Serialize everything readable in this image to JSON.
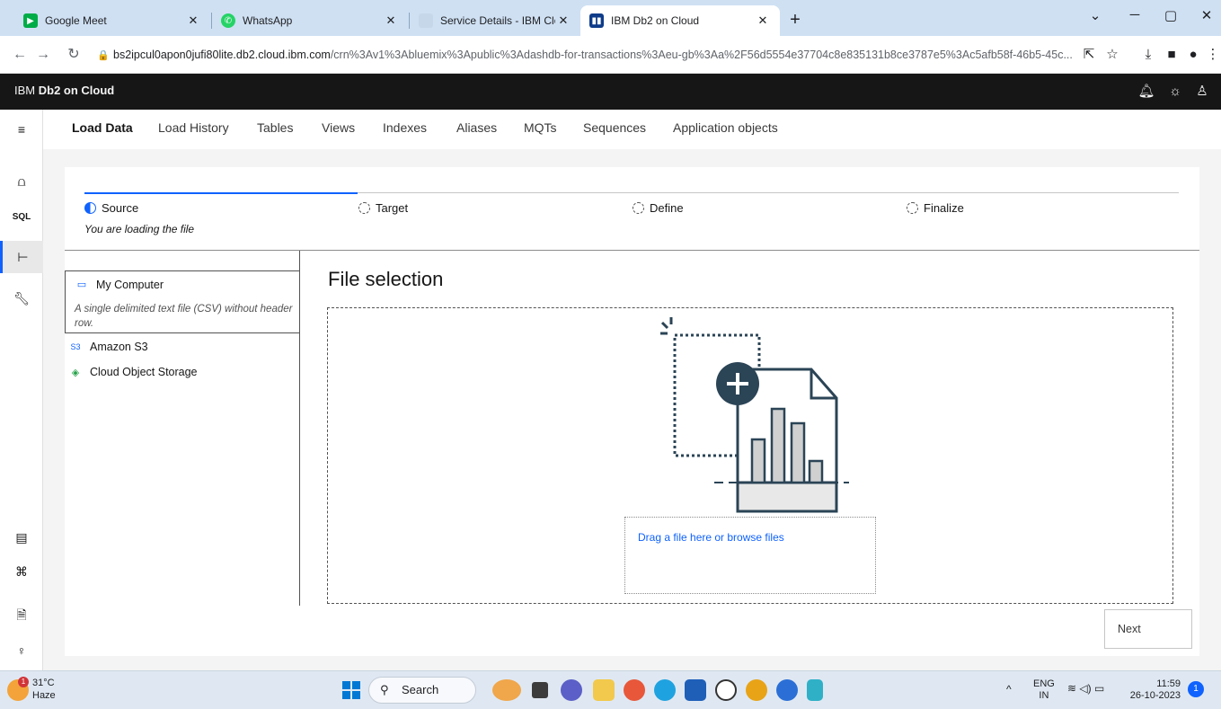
{
  "browser": {
    "tabs": [
      {
        "title": "Google Meet",
        "favicon_color": "#00ac47"
      },
      {
        "title": "WhatsApp",
        "favicon_color": "#25d366"
      },
      {
        "title": "Service Details - IBM Cloud",
        "favicon_color": "#c7d7ea"
      },
      {
        "title": "IBM Db2 on Cloud",
        "favicon_color": "#0f3c8a"
      }
    ],
    "url_host": "bs2ipcul0apon0jufi80lite.db2.cloud.ibm.com",
    "url_path": "/crn%3Av1%3Abluemix%3Apublic%3Adashdb-for-transactions%3Aeu-gb%3Aa%2F56d5554e37704c8e835131b8ce3787e5%3Ac5afb58f-46b5-45c..."
  },
  "app": {
    "brand_prefix": "IBM",
    "brand_name": "Db2 on Cloud"
  },
  "nav_tabs": [
    "Load Data",
    "Load History",
    "Tables",
    "Views",
    "Indexes",
    "Aliases",
    "MQTs",
    "Sequences",
    "Application objects"
  ],
  "progress": {
    "steps": [
      "Source",
      "Target",
      "Define",
      "Finalize"
    ],
    "current_step": 0,
    "current_caption": "You are loading the file"
  },
  "sources": [
    {
      "label": "My Computer",
      "description": "A single delimited text file (CSV) without header row.",
      "icon": "monitor-icon"
    },
    {
      "label": "Amazon S3",
      "icon_text": "S3",
      "icon": "s3-icon"
    },
    {
      "label": "Cloud Object Storage",
      "icon": "cos-icon"
    }
  ],
  "file_selection": {
    "title": "File selection",
    "drop_text": "Drag a file here or browse files"
  },
  "next_label": "Next",
  "taskbar": {
    "weather_temp": "31°C",
    "weather_desc": "Haze",
    "weather_badge": "1",
    "search_label": "Search",
    "lang_top": "ENG",
    "lang_bottom": "IN",
    "time": "11:59",
    "date": "26-10-2023",
    "notif_count": "1"
  },
  "colors": {
    "accent": "#0f62fe",
    "header_bg": "#161616",
    "illus_dark": "#2b4456"
  }
}
